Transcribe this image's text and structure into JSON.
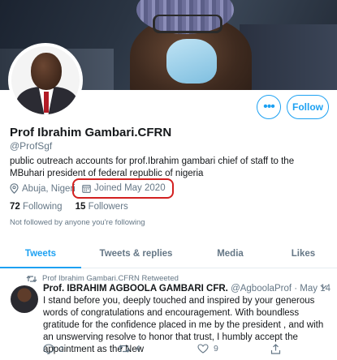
{
  "profile": {
    "name": "Prof Ibrahim Gambari.CFRN",
    "handle": "@ProfSgf",
    "bio": "public outreach accounts for prof.Ibrahim gambari chief of staff to the MBuhari president of federal republic of nigeria",
    "location": "Abuja, Nigeri",
    "joined": "Joined May 2020",
    "following_count": "72",
    "following_label": "Following",
    "followers_count": "15",
    "followers_label": "Followers",
    "not_followed": "Not followed by anyone you're following"
  },
  "buttons": {
    "more_label": "•••",
    "follow_label": "Follow"
  },
  "tabs": [
    {
      "label": "Tweets",
      "active": true
    },
    {
      "label": "Tweets & replies",
      "active": false
    },
    {
      "label": "Media",
      "active": false
    },
    {
      "label": "Likes",
      "active": false
    }
  ],
  "tweet": {
    "retweet_context": "Prof Ibrahim Gambari.CFRN Retweeted",
    "author_name": "Prof. IBRAHIM AGBOOLA GAMBARI CFR.",
    "author_handle": "@AgboolaProf",
    "date": "· May 14",
    "text": "I stand before you, deeply touched and inspired by your generous words of congratulations and encouragement. With boundless gratitude for the confidence placed in me by the president , and with an unswerving resolve to honor that trust, I humbly accept the appointment as the New",
    "replies": "2",
    "retweets": "4",
    "likes": "9"
  },
  "colors": {
    "accent": "#1da1f2",
    "highlight_box": "#d32020",
    "muted": "#657786"
  },
  "icons": {
    "location": "location-pin-icon",
    "calendar": "calendar-icon",
    "retweet": "retweet-icon",
    "reply": "reply-icon",
    "like": "heart-icon",
    "share": "share-icon",
    "caret": "chevron-down-icon"
  }
}
